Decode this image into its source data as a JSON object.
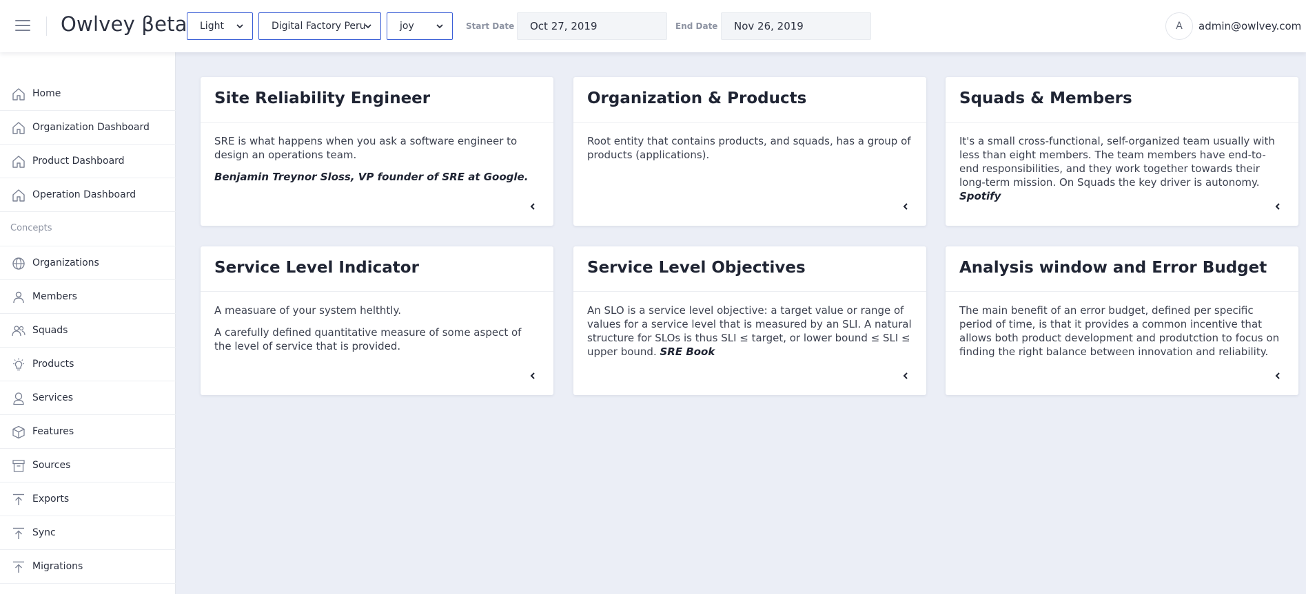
{
  "header": {
    "brand": "Owlvey βeta",
    "theme_select": "Light",
    "organization_select": "Digital Factory Peru",
    "product_select": "joy",
    "start_date_label": "Start Date",
    "start_date_value": "Oct 27, 2019",
    "end_date_label": "End Date",
    "end_date_value": "Nov 26, 2019",
    "avatar_initial": "A",
    "user_email": "admin@owlvey.com"
  },
  "sidebar": {
    "items": [
      {
        "label": "Home",
        "icon": "home-icon"
      },
      {
        "label": "Organization Dashboard",
        "icon": "home-icon"
      },
      {
        "label": "Product Dashboard",
        "icon": "home-icon"
      },
      {
        "label": "Operation Dashboard",
        "icon": "home-icon"
      }
    ],
    "section_label": "Concepts",
    "concepts": [
      {
        "label": "Organizations",
        "icon": "globe-icon"
      },
      {
        "label": "Members",
        "icon": "person-icon"
      },
      {
        "label": "Squads",
        "icon": "people-icon"
      },
      {
        "label": "Products",
        "icon": "bulb-icon"
      },
      {
        "label": "Services",
        "icon": "service-person-icon"
      },
      {
        "label": "Features",
        "icon": "cube-icon"
      },
      {
        "label": "Sources",
        "icon": "archive-icon"
      },
      {
        "label": "Exports",
        "icon": "upload-icon"
      },
      {
        "label": "Sync",
        "icon": "upload-icon"
      },
      {
        "label": "Migrations",
        "icon": "upload-icon"
      }
    ]
  },
  "cards": [
    {
      "title": "Site Reliability Engineer",
      "text": "SRE is what happens when you ask a software engineer to design an operations team.",
      "quote": "Benjamin Treynor Sloss, VP founder of SRE at Google."
    },
    {
      "title": "Organization & Products",
      "text": "Root entity that contains products, and squads, has a group of products (applications)."
    },
    {
      "title": "Squads & Members",
      "text": "It's a small cross-functional, self-organized team usually with less than eight members. The team members have end-to-end responsibilities, and they work together towards their long-term mission. On Squads the key driver is autonomy.",
      "quote": "Spotify"
    },
    {
      "title": "Service Level Indicator",
      "text": "A measuare of your system helthtly.",
      "text2": "A carefully defined quantitative measure of some aspect of the level of service that is provided."
    },
    {
      "title": "Service Level Objectives",
      "text": "An SLO is a service level objective: a target value or range of values for a service level that is measured by an SLI. A natural structure for SLOs is thus SLI ≤ target, or lower bound ≤ SLI ≤ upper bound.",
      "quote": "SRE Book"
    },
    {
      "title": "Analysis window and Error Budget",
      "text": "The main benefit of an error budget, defined per specific period of time, is that it provides a common incentive that allows both product development and produtction to focus on finding the right balance between innovation and reliability."
    }
  ],
  "colors": {
    "accent": "#3a5ed6",
    "background": "#ebeef6",
    "icon": "#7b8294"
  }
}
